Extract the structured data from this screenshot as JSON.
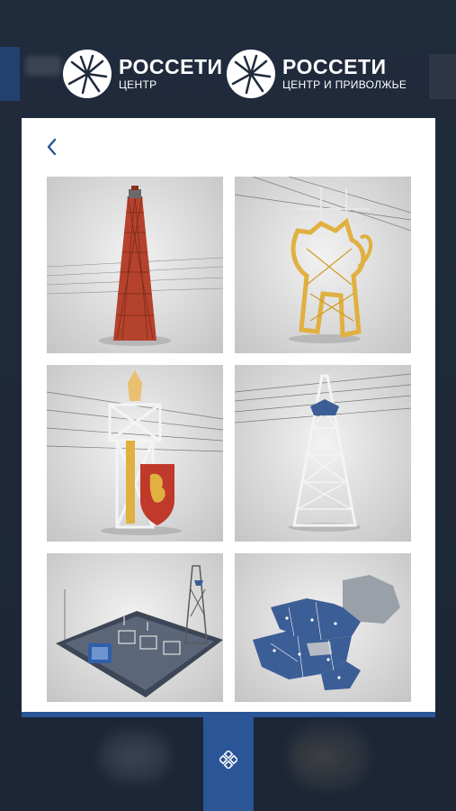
{
  "brands": [
    {
      "name": "РОССЕТИ",
      "subtitle": "ЦЕНТР"
    },
    {
      "name": "РОССЕТИ",
      "subtitle": "ЦЕНТР И ПРИВОЛЖЬЕ"
    }
  ],
  "colors": {
    "background": "#1f2a3b",
    "accent": "#2a5597",
    "panel": "#ffffff",
    "tower_red": "#b5422c",
    "tower_gold": "#e0b040",
    "map_blue": "#3c5e96"
  },
  "back_icon": "chevron-left-icon",
  "menu_icon": "grid-menu-icon",
  "gallery": [
    {
      "id": "shukhov-tower",
      "subject": "red-hyperboloid-tower"
    },
    {
      "id": "lion-pylon",
      "subject": "golden-lion-pylon"
    },
    {
      "id": "knight-pylon",
      "subject": "knight-with-shield-pylon"
    },
    {
      "id": "lattice-pylon",
      "subject": "white-lattice-pylon"
    },
    {
      "id": "substation",
      "subject": "substation-model"
    },
    {
      "id": "region-map",
      "subject": "region-map"
    }
  ]
}
